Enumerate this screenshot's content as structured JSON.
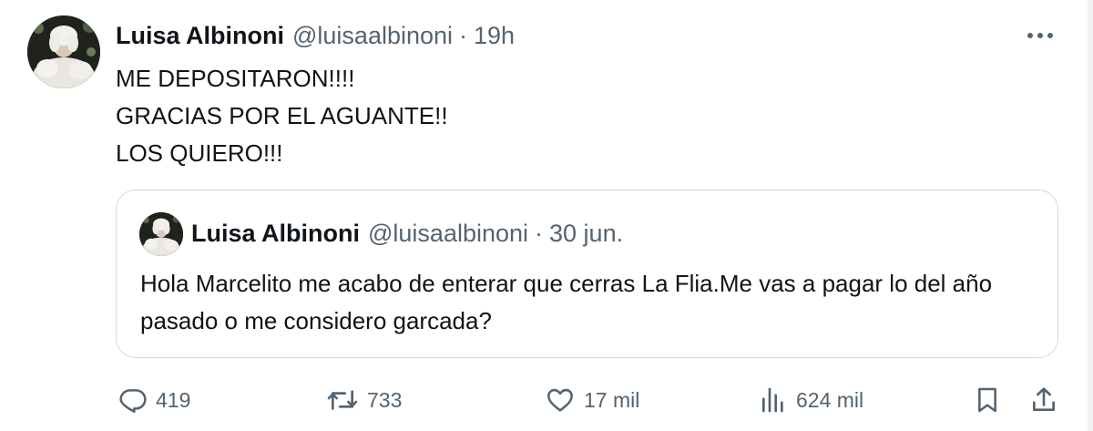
{
  "tweet": {
    "author_name": "Luisa Albinoni",
    "handle": "@luisaalbinoni",
    "separator": "·",
    "time": "19h",
    "lines": [
      "ME DEPOSITARON!!!!",
      "GRACIAS POR EL AGUANTE!!",
      "LOS QUIERO!!!"
    ]
  },
  "quoted": {
    "author_name": "Luisa Albinoni",
    "handle": "@luisaalbinoni",
    "separator": "·",
    "date": "30 jun.",
    "text": "Hola Marcelito me acabo de enterar que cerras La Flia.Me vas a pagar lo del año pasado o me considero garcada?"
  },
  "actions": {
    "replies": "419",
    "reposts": "733",
    "likes": "17 mil",
    "views": "624 mil"
  },
  "icons": {
    "more": "more-horizontal-icon",
    "reply": "reply-icon",
    "repost": "repost-icon",
    "like": "heart-icon",
    "views": "views-icon",
    "bookmark": "bookmark-icon",
    "share": "share-icon"
  },
  "colors": {
    "text": "#0f1419",
    "secondary": "#536471",
    "border": "#cfd9de"
  }
}
